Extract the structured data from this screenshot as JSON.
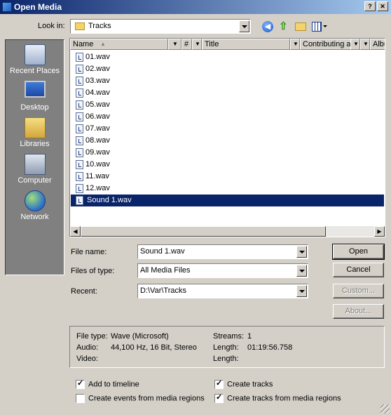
{
  "window": {
    "title": "Open Media"
  },
  "lookin": {
    "label": "Look in:",
    "folder": "Tracks"
  },
  "places": [
    {
      "label": "Recent Places",
      "icon": "recent-places-icon"
    },
    {
      "label": "Desktop",
      "icon": "desktop-icon"
    },
    {
      "label": "Libraries",
      "icon": "libraries-icon"
    },
    {
      "label": "Computer",
      "icon": "computer-icon"
    },
    {
      "label": "Network",
      "icon": "network-icon"
    }
  ],
  "columns": [
    "Name",
    "#",
    "Title",
    "Contributing a...",
    "Album"
  ],
  "files": [
    "01.wav",
    "02.wav",
    "03.wav",
    "04.wav",
    "05.wav",
    "06.wav",
    "07.wav",
    "08.wav",
    "09.wav",
    "10.wav",
    "11.wav",
    "12.wav",
    "Sound 1.wav"
  ],
  "selected_file": "Sound 1.wav",
  "form": {
    "filename_label": "File name:",
    "filename_value": "Sound 1.wav",
    "filetype_label": "Files of type:",
    "filetype_value": "All Media Files",
    "recent_label": "Recent:",
    "recent_value": "D:\\Var\\Tracks"
  },
  "buttons": {
    "open": "Open",
    "cancel": "Cancel",
    "custom": "Custom...",
    "about": "About..."
  },
  "info": {
    "filetype_label": "File type:",
    "filetype_value": "Wave (Microsoft)",
    "audio_label": "Audio:",
    "audio_value": "44,100 Hz, 16 Bit, Stereo",
    "video_label": "Video:",
    "video_value": "",
    "streams_label": "Streams:",
    "streams_value": "1",
    "length_label": "Length:",
    "length_value": "01:19:56.758",
    "length2_label": "Length:",
    "length2_value": ""
  },
  "options": {
    "add_to_timeline": {
      "label": "Add to timeline",
      "checked": true
    },
    "create_events": {
      "label": "Create events from media regions",
      "checked": false
    },
    "create_tracks": {
      "label": "Create tracks",
      "checked": true
    },
    "create_tracks_regions": {
      "label": "Create tracks from media regions",
      "checked": true
    }
  }
}
